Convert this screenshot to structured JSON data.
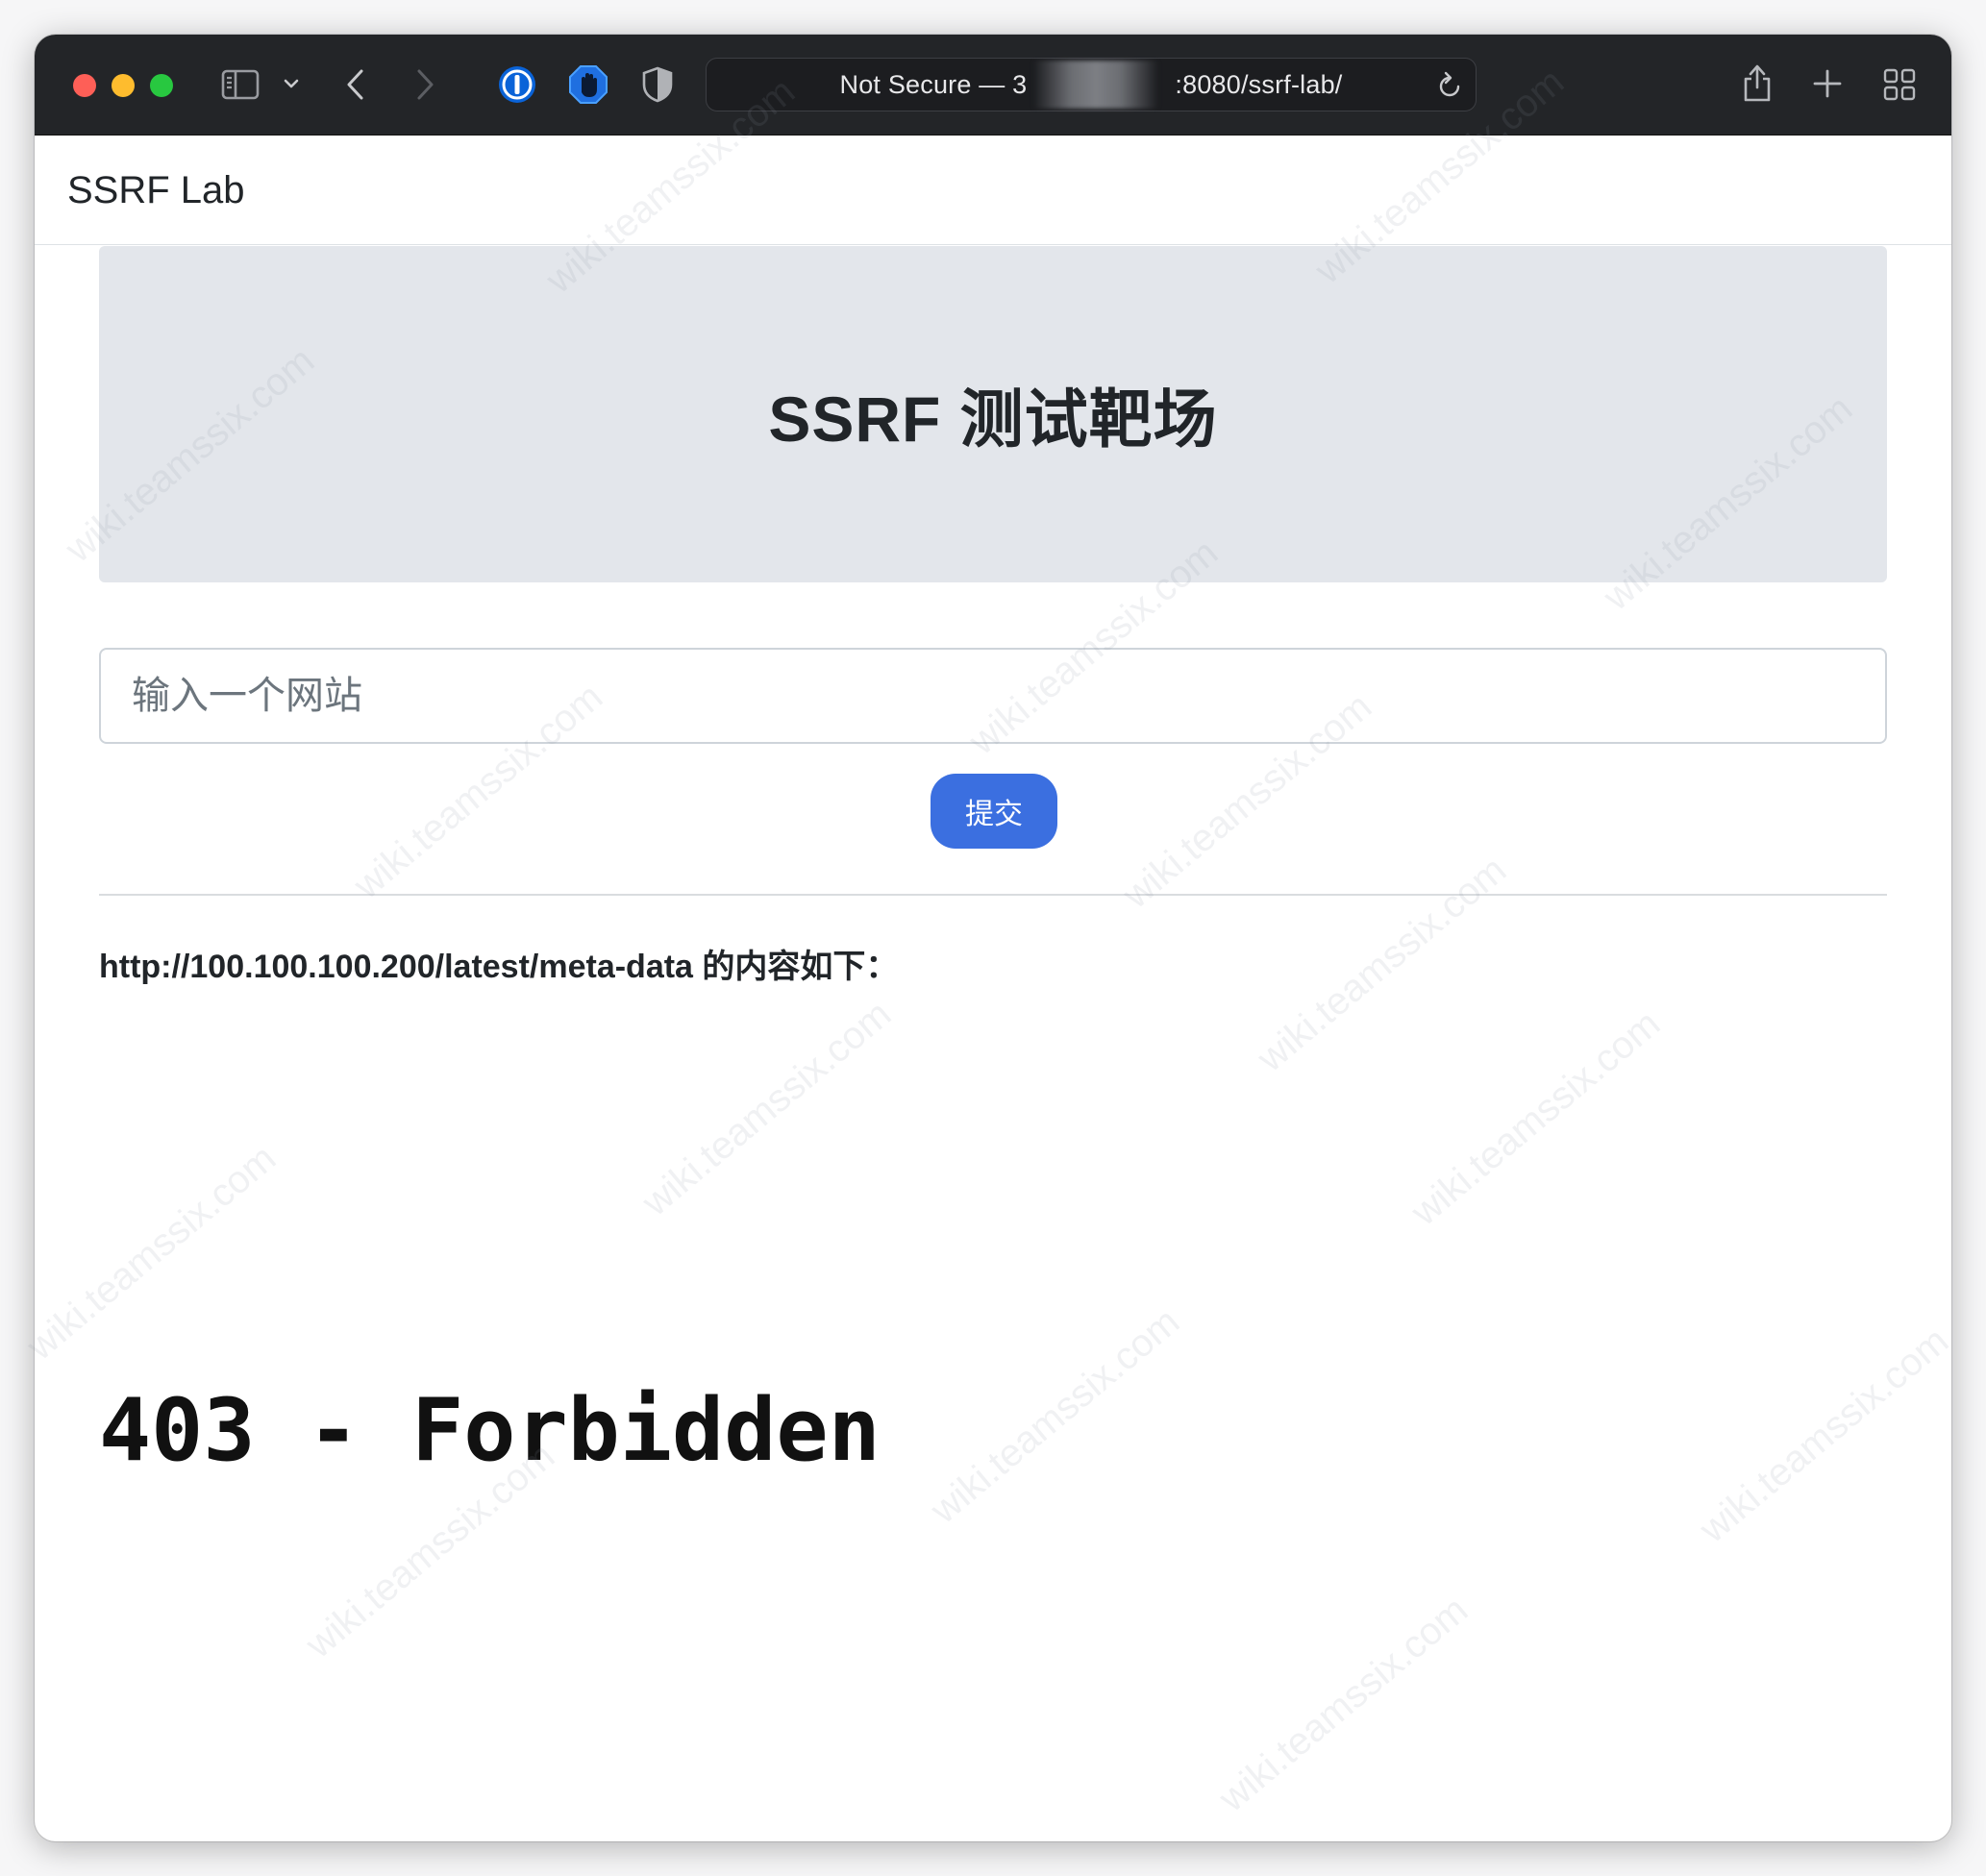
{
  "browser": {
    "address_text": "Not Secure — 3                    :8080/ssrf-lab/",
    "address_prefix": "Not Secure — 3",
    "address_suffix": ":8080/ssrf-lab/"
  },
  "navbar": {
    "brand": "SSRF Lab"
  },
  "jumbotron": {
    "title": "SSRF 测试靶场"
  },
  "form": {
    "input_placeholder": "输入一个网站",
    "input_value": "",
    "submit_label": "提交"
  },
  "result": {
    "label": "http://100.100.100.200/latest/meta-data 的内容如下：",
    "body": "403 - Forbidden"
  },
  "watermark_text": "wiki.teamssix.com",
  "colors": {
    "toolbar": "#232528",
    "jumbotron": "#e3e6eb",
    "primary_button": "#3b6fe0",
    "traffic_red": "#fe5f57",
    "traffic_yellow": "#febc2e",
    "traffic_green": "#28c840"
  }
}
